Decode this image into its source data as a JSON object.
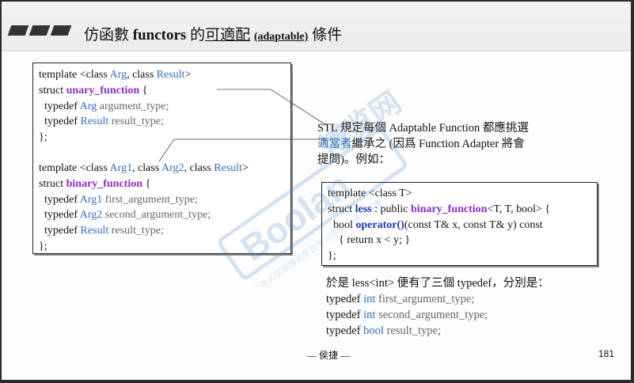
{
  "header": {
    "title_prefix": "仿函數",
    "title_keyword": "functors",
    "title_mid": " 的",
    "title_adapt": "可適配",
    "title_paren": "(adaptable)",
    "title_suffix": " 條件"
  },
  "left_box": {
    "l1a": "template <class ",
    "l1b": "Arg",
    "l1c": ", class ",
    "l1d": "Result",
    "l1e": ">",
    "l2a": "struct ",
    "l2b": "unary_function",
    "l2c": " {",
    "l3a": "  typedef ",
    "l3b": "Arg",
    "l3c": " argument_type;",
    "l4a": "  typedef ",
    "l4b": "Result",
    "l4c": " result_type;",
    "l5": "};",
    "l6a": "template <class ",
    "l6b": "Arg1",
    "l6c": ", class ",
    "l6d": "Arg2",
    "l6e": ", class ",
    "l6f": "Result",
    "l6g": ">",
    "l7a": "struct ",
    "l7b": "binary_function",
    "l7c": " {",
    "l8a": "  typedef ",
    "l8b": "Arg1",
    "l8c": " first_argument_type;",
    "l9a": "  typedef ",
    "l9b": "Arg2",
    "l9c": " second_argument_type;",
    "l10a": "  typedef ",
    "l10b": "Result",
    "l10c": " result_type;",
    "l11": "};"
  },
  "note": {
    "line1": "STL 規定每個 Adaptable Function 都應挑選",
    "line2a": "適當者",
    "line2b": "繼承之 (因爲 Function Adapter 將會",
    "line3": "提問)。例如："
  },
  "right_box": {
    "r1": "template <class T>",
    "r2a": "struct ",
    "r2b": "less",
    "r2c": " : public ",
    "r2d": "binary_function",
    "r2e": "<T, T, bool> {",
    "r3a": "  bool ",
    "r3b": "operator()",
    "r3c": "(const T& x, const T& y) const",
    "r4": "    { return x < y; }",
    "r5": "};"
  },
  "bottom": {
    "intro": "於是 less<int> 便有了三個 typedef，分別是：",
    "b1a": "typedef ",
    "b1b": "int",
    "b1c": " first_argument_type;",
    "b2a": "typedef ",
    "b2b": "int",
    "b2c": " second_argument_type;",
    "b3a": "typedef ",
    "b3b": "bool",
    "b3c": " result_type;"
  },
  "footer": {
    "author": "— 侯捷 —",
    "page_number": "181"
  },
  "watermark": {
    "brand": "Boolan",
    "brand_cn": "博览网",
    "notice": "本讲义仅供博览学员学习使用，请勿传播"
  }
}
